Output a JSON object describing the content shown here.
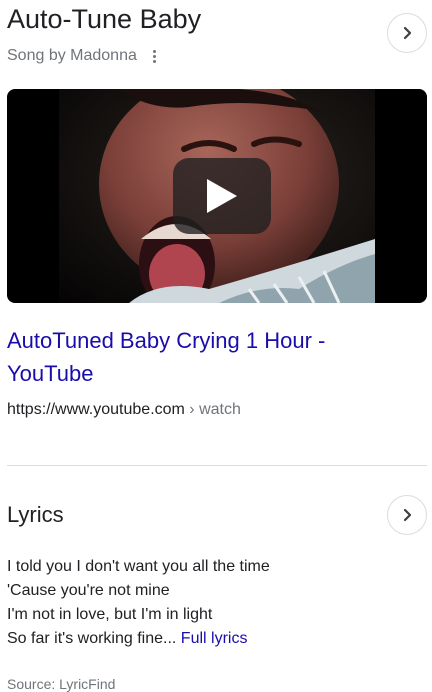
{
  "header": {
    "title": "Auto-Tune Baby",
    "subtitle": "Song by Madonna"
  },
  "video": {
    "thumbnail_icon": "crying-baby-thumbnail",
    "play_icon": "play-icon"
  },
  "result": {
    "title": "AutoTuned Baby Crying 1 Hour - YouTube",
    "url_host": "https://www.youtube.com",
    "url_path": " › watch"
  },
  "lyrics": {
    "heading": "Lyrics",
    "lines": [
      "I told you I don't want you all the time",
      "'Cause you're not mine",
      "I'm not in love, but I'm in light",
      "So far it's working fine..."
    ],
    "full_lyrics_link": "Full lyrics",
    "source": "Source: LyricFind"
  },
  "colors": {
    "link": "#1a0dab",
    "secondary_text": "#70757a",
    "divider": "#dadce0"
  }
}
